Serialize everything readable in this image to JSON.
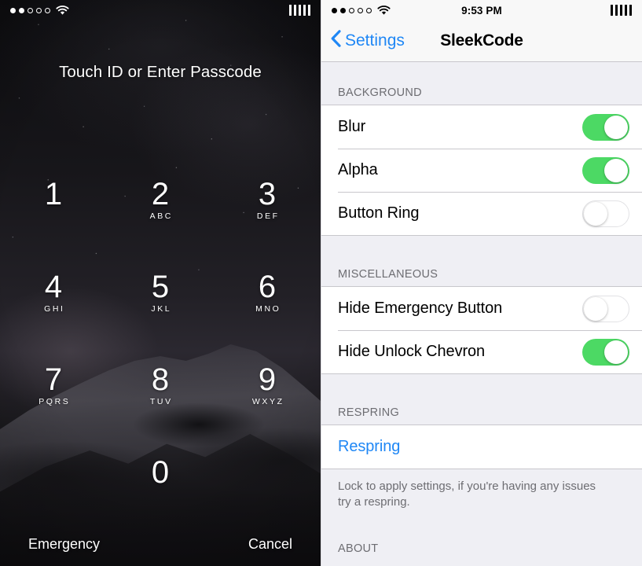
{
  "lockscreen": {
    "status": {
      "signal_dots_filled": 2,
      "signal_dots_total": 5,
      "wifi_icon": "wifi-icon",
      "battery_icon": "battery-bars-icon",
      "battery_bars": 5
    },
    "prompt": "Touch ID or Enter Passcode",
    "keypad": [
      {
        "digit": "1",
        "letters": ""
      },
      {
        "digit": "2",
        "letters": "ABC"
      },
      {
        "digit": "3",
        "letters": "DEF"
      },
      {
        "digit": "4",
        "letters": "GHI"
      },
      {
        "digit": "5",
        "letters": "JKL"
      },
      {
        "digit": "6",
        "letters": "MNO"
      },
      {
        "digit": "7",
        "letters": "PQRS"
      },
      {
        "digit": "8",
        "letters": "TUV"
      },
      {
        "digit": "9",
        "letters": "WXYZ"
      },
      {
        "digit": "0",
        "letters": ""
      }
    ],
    "emergency_label": "Emergency",
    "cancel_label": "Cancel"
  },
  "settings": {
    "status": {
      "signal_dots_filled": 2,
      "signal_dots_total": 5,
      "wifi_icon": "wifi-icon",
      "time": "9:53 PM",
      "battery_icon": "battery-bars-icon",
      "battery_bars": 5
    },
    "nav": {
      "back_icon": "chevron-left-icon",
      "back_label": "Settings",
      "title": "SleekCode"
    },
    "sections": [
      {
        "header": "BACKGROUND",
        "rows": [
          {
            "label": "Blur",
            "toggle": "on"
          },
          {
            "label": "Alpha",
            "toggle": "on"
          },
          {
            "label": "Button Ring",
            "toggle": "off"
          }
        ]
      },
      {
        "header": "MISCELLANEOUS",
        "rows": [
          {
            "label": "Hide Emergency Button",
            "toggle": "off"
          },
          {
            "label": "Hide Unlock Chevron",
            "toggle": "on"
          }
        ]
      },
      {
        "header": "RESPRING",
        "rows": [
          {
            "label": "Respring",
            "toggle": "none"
          }
        ],
        "footnote": "Lock to apply settings, if you're having any issues try a respring."
      },
      {
        "header": "ABOUT",
        "rows": []
      }
    ],
    "colors": {
      "accent_blue": "#1f87f5",
      "toggle_on_green": "#4CD964",
      "group_background": "#EFEFF4",
      "separator": "#c8c7cc",
      "header_text": "#6d6d72"
    }
  }
}
